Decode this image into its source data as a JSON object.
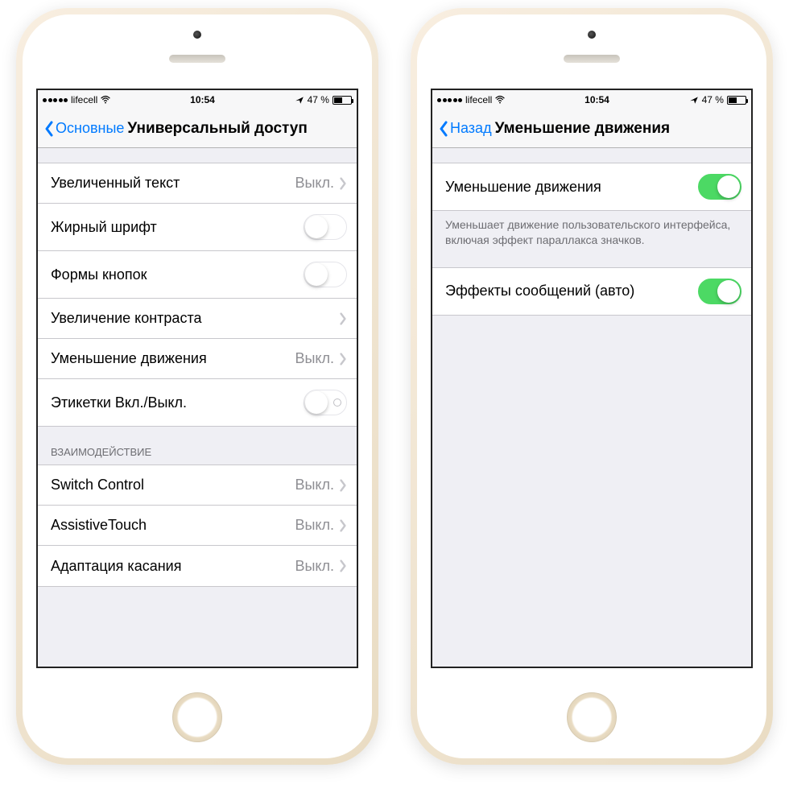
{
  "status": {
    "carrier": "lifecell",
    "time": "10:54",
    "battery_text": "47 %"
  },
  "left": {
    "back_label": "Основные",
    "title": "Универсальный доступ",
    "group1": [
      {
        "label": "Увеличенный текст",
        "value": "Выкл."
      },
      {
        "label": "Жирный шрифт"
      },
      {
        "label": "Формы кнопок"
      },
      {
        "label": "Увеличение контраста"
      },
      {
        "label": "Уменьшение движения",
        "value": "Выкл."
      },
      {
        "label": "Этикетки Вкл./Выкл."
      }
    ],
    "section2_header": "ВЗАИМОДЕЙСТВИЕ",
    "group2": [
      {
        "label": "Switch Control",
        "value": "Выкл."
      },
      {
        "label": "AssistiveTouch",
        "value": "Выкл."
      },
      {
        "label": "Адаптация касания",
        "value": "Выкл."
      }
    ]
  },
  "right": {
    "back_label": "Назад",
    "title": "Уменьшение движения",
    "row1_label": "Уменьшение движения",
    "footer": "Уменьшает движение пользовательского интерфейса, включая эффект параллакса значков.",
    "row2_label": "Эффекты сообщений (авто)"
  }
}
